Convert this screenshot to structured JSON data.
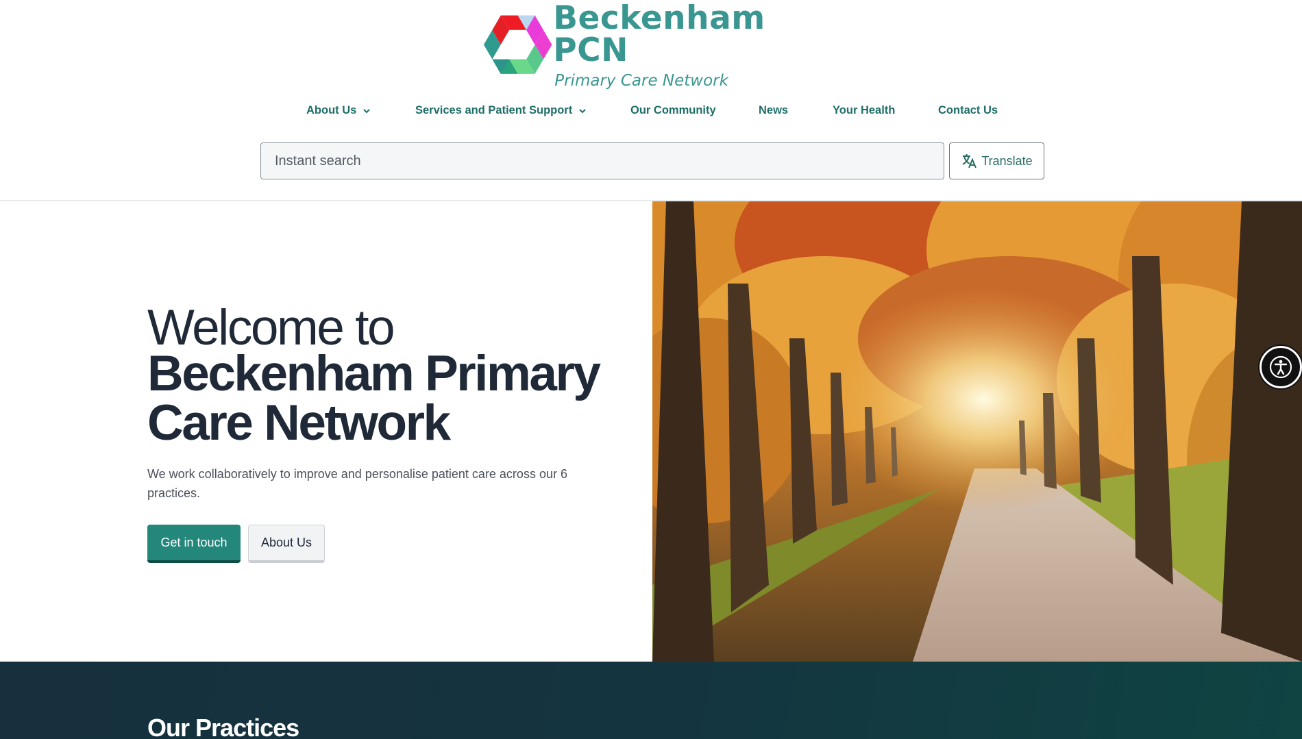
{
  "brand": {
    "name": "Beckenham PCN",
    "tagline": "Primary Care Network"
  },
  "nav": {
    "items": [
      {
        "label": "About Us",
        "has_dropdown": true
      },
      {
        "label": "Services and Patient Support",
        "has_dropdown": true
      },
      {
        "label": "Our Community",
        "has_dropdown": false
      },
      {
        "label": "News",
        "has_dropdown": false
      },
      {
        "label": "Your Health",
        "has_dropdown": false
      },
      {
        "label": "Contact Us",
        "has_dropdown": false
      }
    ]
  },
  "search": {
    "placeholder": "Instant search",
    "value": ""
  },
  "translate": {
    "label": "Translate",
    "icon": "translate-icon"
  },
  "hero": {
    "title_line1": "Welcome to",
    "title_line2": "Beckenham Primary Care Network",
    "lead": "We work collaboratively to improve and personalise patient care across our 6 practices.",
    "primary_button": "Get in touch",
    "secondary_button": "About Us",
    "image": "autumn tree-lined path"
  },
  "accessibility": {
    "icon": "accessibility-icon"
  },
  "practices": {
    "title_light": "Our",
    "title_bold": "Practices"
  },
  "colors": {
    "brand_teal": "#3a9690",
    "nav_text": "#1e6e68",
    "primary_button": "#23877b",
    "heading": "#1f2937",
    "band_dark": "#16303d"
  }
}
